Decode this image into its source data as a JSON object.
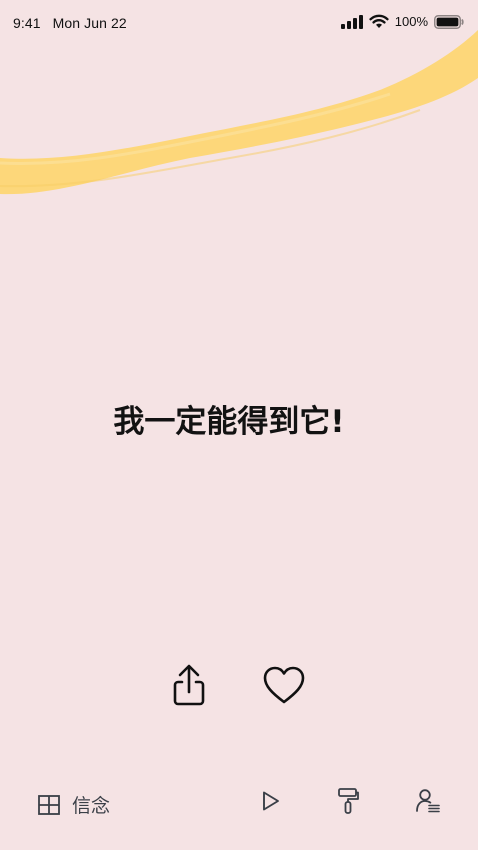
{
  "status_bar": {
    "time": "9:41",
    "date": "Mon Jun 22",
    "battery": "100%",
    "icons": [
      "cellular-signal-icon",
      "wifi-icon",
      "battery-icon"
    ]
  },
  "quote": {
    "text": "我一定能得到它!"
  },
  "actions": {
    "share_icon": "share-icon",
    "like_icon": "heart-icon"
  },
  "bottom_bar": {
    "category_label": "信念",
    "category_icon": "grid-icon",
    "nav_icons": [
      "play-icon",
      "paint-roller-icon",
      "profile-list-icon"
    ]
  },
  "colors": {
    "background": "#f5e3e4",
    "brush": "#fdd77a",
    "icon_dark": "#111111",
    "icon_muted": "#3a3f47"
  }
}
